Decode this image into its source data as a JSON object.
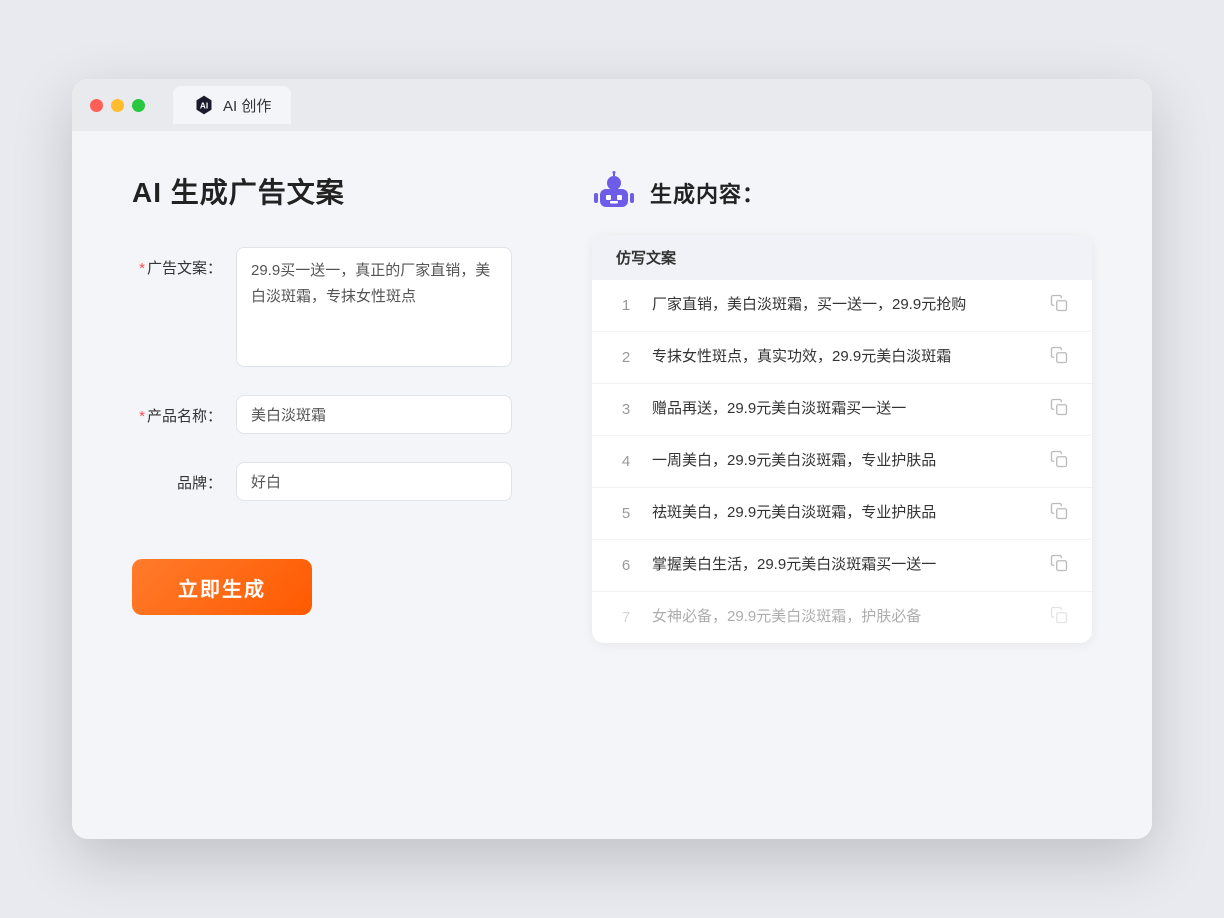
{
  "browser": {
    "tab_label": "AI 创作"
  },
  "page": {
    "title": "AI 生成广告文案",
    "result_title": "生成内容："
  },
  "form": {
    "ad_copy_label": "广告文案：",
    "ad_copy_required": true,
    "ad_copy_value": "29.9买一送一，真正的厂家直销，美白淡斑霜，专抹女性斑点",
    "product_name_label": "产品名称：",
    "product_name_required": true,
    "product_name_value": "美白淡斑霜",
    "brand_label": "品牌：",
    "brand_required": false,
    "brand_value": "好白",
    "generate_btn_label": "立即生成"
  },
  "results": {
    "table_header": "仿写文案",
    "items": [
      {
        "num": "1",
        "text": "厂家直销，美白淡斑霜，买一送一，29.9元抢购",
        "faded": false
      },
      {
        "num": "2",
        "text": "专抹女性斑点，真实功效，29.9元美白淡斑霜",
        "faded": false
      },
      {
        "num": "3",
        "text": "赠品再送，29.9元美白淡斑霜买一送一",
        "faded": false
      },
      {
        "num": "4",
        "text": "一周美白，29.9元美白淡斑霜，专业护肤品",
        "faded": false
      },
      {
        "num": "5",
        "text": "祛斑美白，29.9元美白淡斑霜，专业护肤品",
        "faded": false
      },
      {
        "num": "6",
        "text": "掌握美白生活，29.9元美白淡斑霜买一送一",
        "faded": false
      },
      {
        "num": "7",
        "text": "女神必备，29.9元美白淡斑霜，护肤必备",
        "faded": true
      }
    ]
  }
}
